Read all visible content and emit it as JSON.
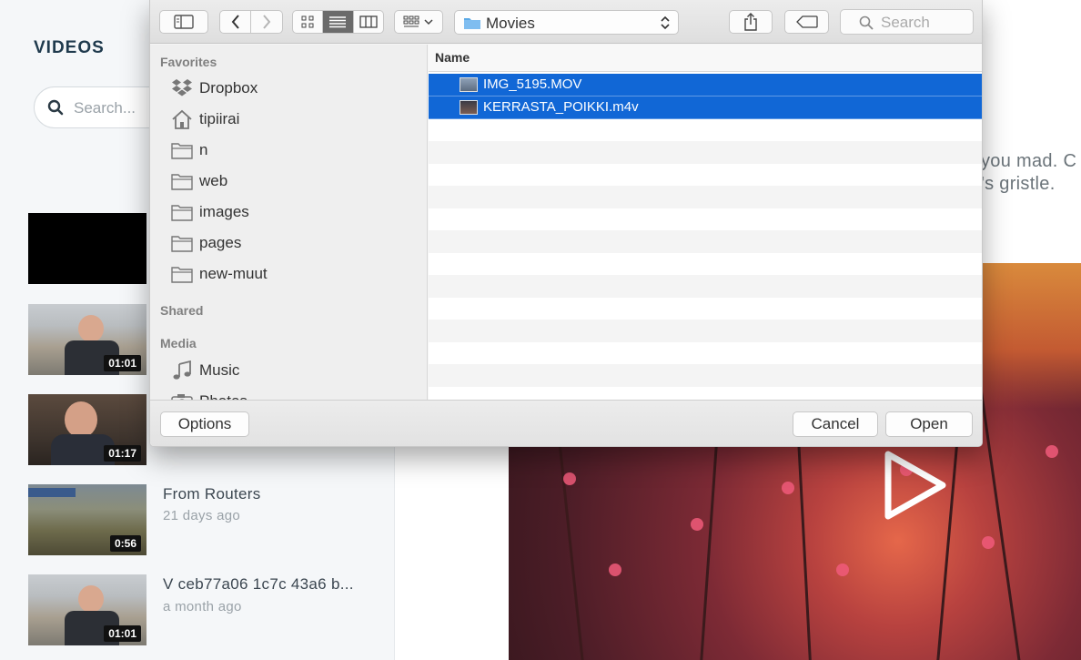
{
  "app": {
    "title": "VIDEOS",
    "search_placeholder": "Search...",
    "videos": [
      {
        "duration": "",
        "title": "",
        "meta": ""
      },
      {
        "duration": "01:01",
        "title": "",
        "meta": ""
      },
      {
        "duration": "01:17",
        "title": "",
        "meta": ""
      },
      {
        "duration": "0:56",
        "title": "From Routers",
        "meta": "21 days ago"
      },
      {
        "duration": "01:01",
        "title": "V ceb77a06 1c7c 43a6 b...",
        "meta": "a month ago"
      }
    ],
    "description_lines": [
      "you mad. C",
      "'s gristle."
    ]
  },
  "dialog": {
    "location": "Movies",
    "search_placeholder": "Search",
    "column_name": "Name",
    "sidebar": {
      "favorites_label": "Favorites",
      "favorites": [
        {
          "label": "Dropbox",
          "icon": "dropbox-icon"
        },
        {
          "label": "tipiirai",
          "icon": "home-icon"
        },
        {
          "label": "n",
          "icon": "folder-icon"
        },
        {
          "label": "web",
          "icon": "folder-icon"
        },
        {
          "label": "images",
          "icon": "folder-icon"
        },
        {
          "label": "pages",
          "icon": "folder-icon"
        },
        {
          "label": "new-muut",
          "icon": "folder-icon"
        }
      ],
      "shared_label": "Shared",
      "media_label": "Media",
      "media": [
        {
          "label": "Music",
          "icon": "music-note-icon"
        },
        {
          "label": "Photos",
          "icon": "camera-icon"
        }
      ]
    },
    "files": [
      {
        "name": "IMG_5195.MOV",
        "selected": true
      },
      {
        "name": "KERRASTA_POIKKI.m4v",
        "selected": true
      }
    ],
    "buttons": {
      "options": "Options",
      "cancel": "Cancel",
      "open": "Open"
    },
    "colors": {
      "selection": "#1167d6",
      "folder_accent": "#5aa9e6"
    }
  }
}
